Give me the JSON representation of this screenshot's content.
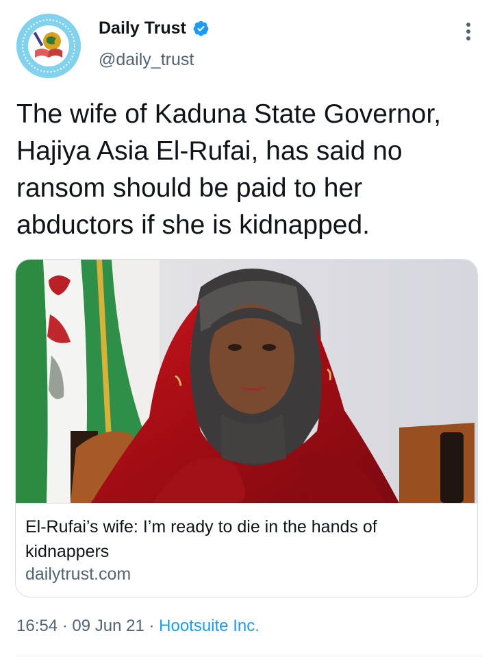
{
  "account": {
    "name": "Daily Trust",
    "handle": "@daily_trust",
    "avatar_icon": "daily-trust-logo",
    "verified_icon": "verified-badge-icon"
  },
  "tweet": {
    "text": "The wife of Kaduna State Governor, Hajiya Asia El-Rufai, has said no ransom should be paid to her abductors if she is kidnapped."
  },
  "card": {
    "image_description": "woman-in-red-hijab-with-nigerian-flag",
    "title": "El-Rufai’s wife: I’m ready to die in the hands of kidnappers",
    "domain": "dailytrust.com"
  },
  "meta": {
    "time": "16:54",
    "separator1": " · ",
    "date": "09 Jun 21",
    "separator2": " · ",
    "source": "Hootsuite Inc."
  },
  "colors": {
    "accent": "#1d9bf0",
    "text": "#0f1419",
    "secondary": "#536471",
    "avatar_bg": "#7fd0ec"
  }
}
